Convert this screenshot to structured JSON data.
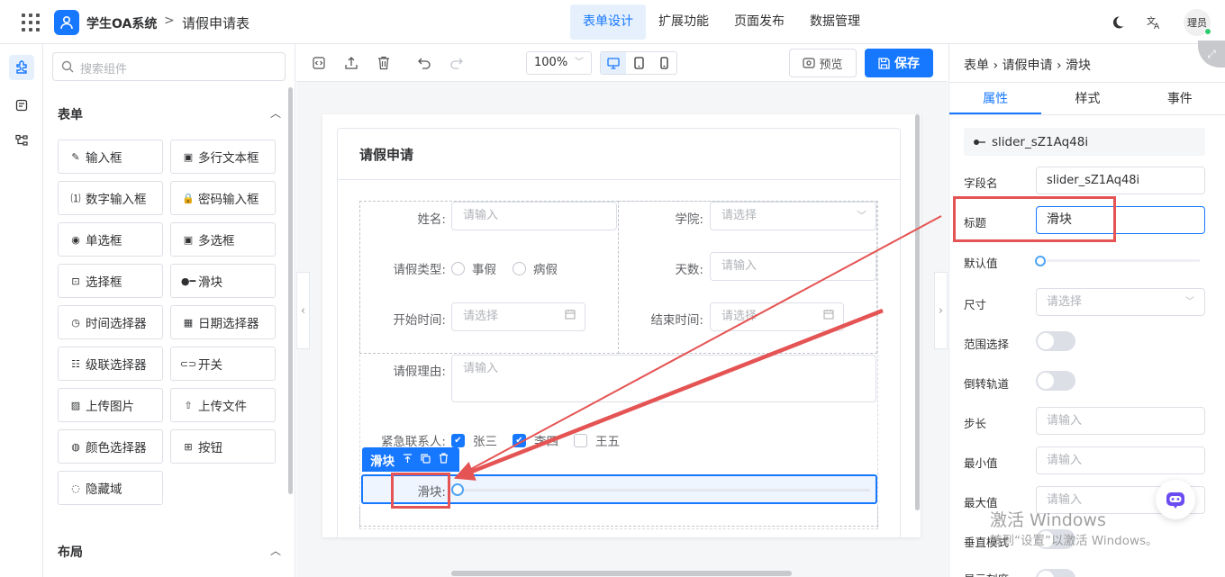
{
  "header": {
    "app_name": "学生OA系统",
    "separator": ">",
    "page_name": "请假申请表",
    "nav": [
      "表单设计",
      "扩展功能",
      "页面发布",
      "数据管理"
    ],
    "user": "理员"
  },
  "library": {
    "search_placeholder": "搜索组件",
    "section_form": "表单",
    "section_layout": "布局",
    "components": [
      {
        "icon": "pencil-icon",
        "label": "输入框"
      },
      {
        "icon": "textarea-icon",
        "label": "多行文本框"
      },
      {
        "icon": "number-icon",
        "label": "数字输入框"
      },
      {
        "icon": "lock-icon",
        "label": "密码输入框"
      },
      {
        "icon": "radio-icon",
        "label": "单选框"
      },
      {
        "icon": "checkbox-icon",
        "label": "多选框"
      },
      {
        "icon": "select-icon",
        "label": "选择框"
      },
      {
        "icon": "slider-icon",
        "label": "滑块"
      },
      {
        "icon": "clock-icon",
        "label": "时间选择器"
      },
      {
        "icon": "calendar-icon",
        "label": "日期选择器"
      },
      {
        "icon": "cascader-icon",
        "label": "级联选择器"
      },
      {
        "icon": "switch-icon",
        "label": "开关"
      },
      {
        "icon": "image-icon",
        "label": "上传图片"
      },
      {
        "icon": "upload-icon",
        "label": "上传文件"
      },
      {
        "icon": "palette-icon",
        "label": "颜色选择器"
      },
      {
        "icon": "button-icon",
        "label": "按钮"
      },
      {
        "icon": "eye-off-icon",
        "label": "隐藏域"
      }
    ]
  },
  "toolbar": {
    "zoom": "100%",
    "preview": "预览",
    "save": "保存"
  },
  "form": {
    "title": "请假申请",
    "name_label": "姓名:",
    "name_placeholder": "请输入",
    "college_label": "学院:",
    "college_placeholder": "请选择",
    "type_label": "请假类型:",
    "type_options": [
      "事假",
      "病假"
    ],
    "days_label": "天数:",
    "days_placeholder": "请输入",
    "start_label": "开始时间:",
    "start_placeholder": "请选择",
    "end_label": "结束时间:",
    "end_placeholder": "请选择",
    "reason_label": "请假理由:",
    "reason_placeholder": "请输入",
    "contact_label": "紧急联系人:",
    "contacts": [
      {
        "name": "张三",
        "checked": true
      },
      {
        "name": "李四",
        "checked": true
      },
      {
        "name": "王五",
        "checked": false
      }
    ],
    "selected_tag": "滑块",
    "slider_label": "滑块:"
  },
  "props": {
    "breadcrumb": [
      "表单",
      "请假申请",
      "滑块"
    ],
    "tabs": [
      "属性",
      "样式",
      "事件"
    ],
    "component_id": "slider_sZ1Aq48i",
    "field_label": "字段名",
    "field_value": "slider_sZ1Aq48i",
    "title_label": "标题",
    "title_value": "滑块",
    "default_label": "默认值",
    "size_label": "尺寸",
    "size_placeholder": "请选择",
    "range_label": "范围选择",
    "reverse_label": "倒转轨道",
    "step_label": "步长",
    "step_placeholder": "请输入",
    "min_label": "最小值",
    "min_placeholder": "请输入",
    "max_label": "最大值",
    "max_placeholder": "请输入",
    "vertical_label": "垂直模式",
    "ticks_label": "显示刻度"
  },
  "watermark": {
    "line1": "激活 Windows",
    "line2": "转到“设置”以激活 Windows。"
  },
  "colors": {
    "primary": "#1677ff",
    "annotation": "#e55454"
  }
}
